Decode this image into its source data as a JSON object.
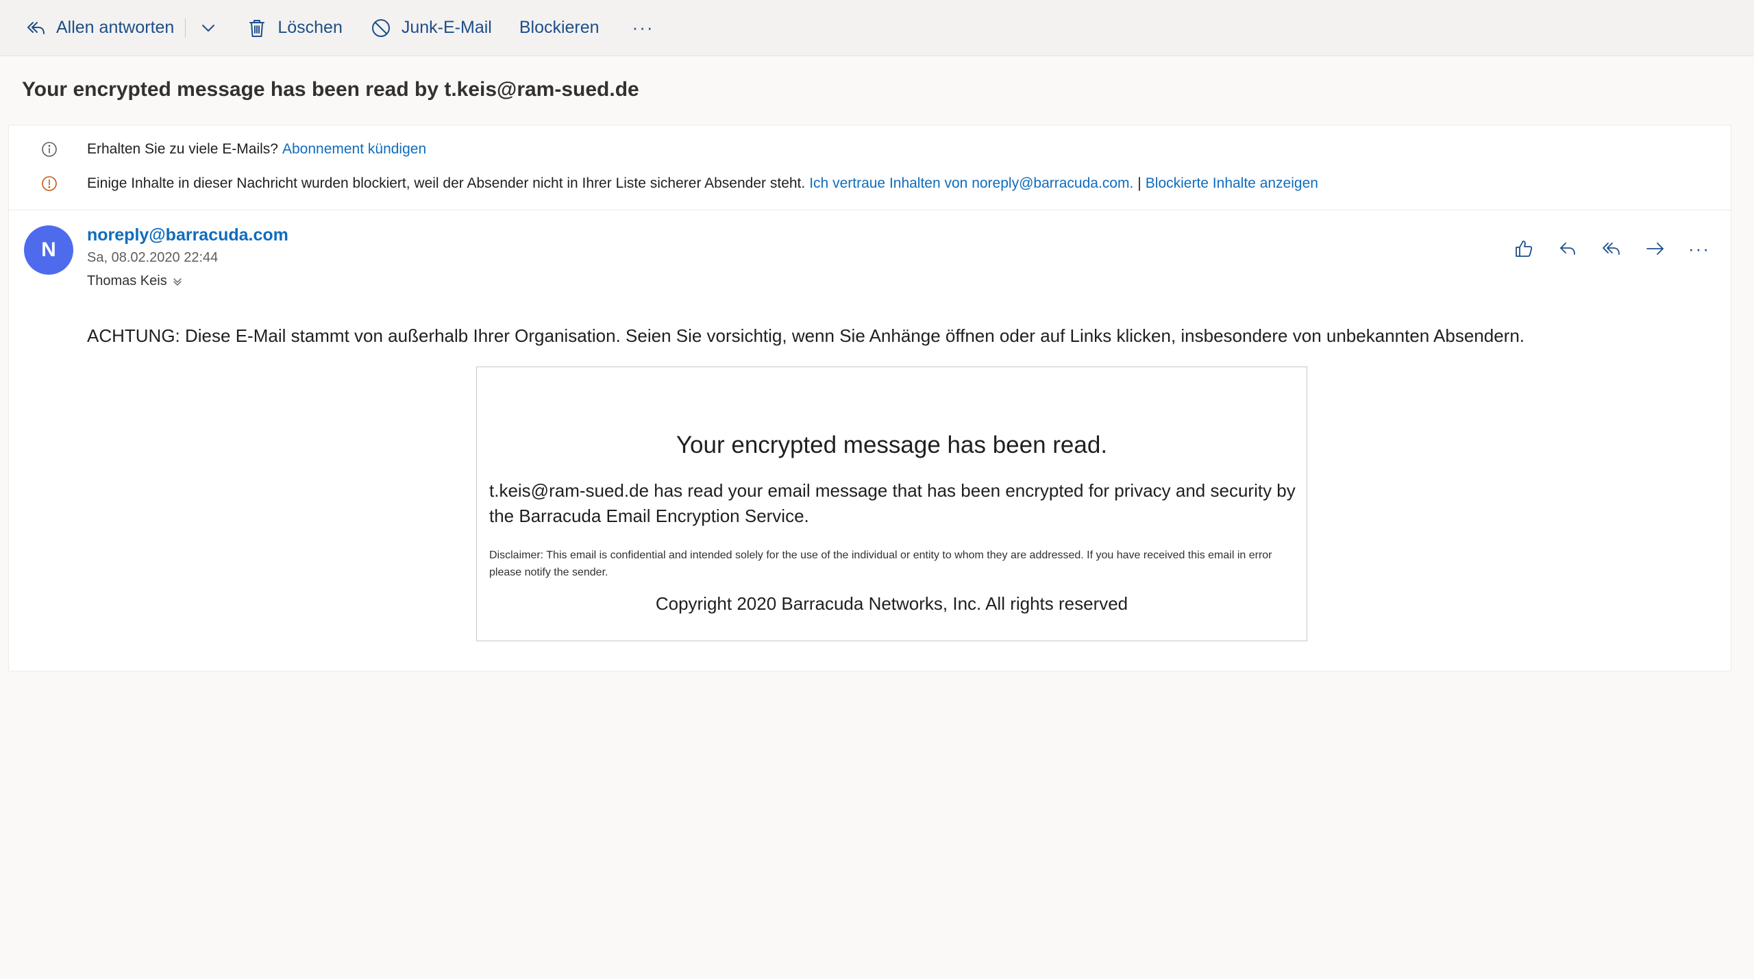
{
  "toolbar": {
    "reply_all_label": "Allen antworten",
    "delete_label": "Löschen",
    "junk_label": "Junk-E-Mail",
    "block_label": "Blockieren",
    "more_label": "···"
  },
  "message": {
    "subject": "Your encrypted message has been read by t.keis@ram-sued.de",
    "infobar": {
      "unsubscribe_text": "Erhalten Sie zu viele E-Mails?",
      "unsubscribe_link": "Abonnement kündigen",
      "blocked_text": "Einige Inhalte in dieser Nachricht wurden blockiert, weil der Absender nicht in Ihrer Liste sicherer Absender steht.",
      "trust_link": "Ich vertraue Inhalten von noreply@barracuda.com.",
      "separator": "|",
      "show_blocked_link": "Blockierte Inhalte anzeigen"
    },
    "avatar_initial": "N",
    "sender": "noreply@barracuda.com",
    "date": "Sa, 08.02.2020 22:44",
    "recipient": "Thomas Keis",
    "actions_more": "···",
    "warning": "ACHTUNG: Diese E-Mail stammt von außerhalb Ihrer Organisation. Seien Sie vorsichtig, wenn Sie Anhänge öffnen oder auf Links klicken, insbesondere von unbekannten Absendern.",
    "body": {
      "title": "Your encrypted message has been read.",
      "text": "t.keis@ram-sued.de has read your email message that has been encrypted for privacy and security by the Barracuda Email Encryption Service.",
      "disclaimer": "Disclaimer: This email is confidential and intended solely for the use of the individual or entity to whom they are addressed. If you have received this email in error please notify the sender.",
      "copyright": "Copyright 2020 Barracuda Networks, Inc. All rights reserved"
    }
  },
  "icons": {
    "reply_all": "reply-all-icon",
    "chevron": "chevron-down-icon",
    "delete": "trash-icon",
    "junk": "block-icon",
    "info": "info-icon",
    "warning": "warning-icon",
    "like": "thumbs-up-icon",
    "reply": "reply-icon",
    "forward": "forward-icon",
    "expand": "double-chevron-down-icon"
  },
  "colors": {
    "accent": "#1d4e89",
    "link": "#0f6cbd",
    "avatar": "#4f6bed",
    "warning_icon": "#c4591b"
  }
}
